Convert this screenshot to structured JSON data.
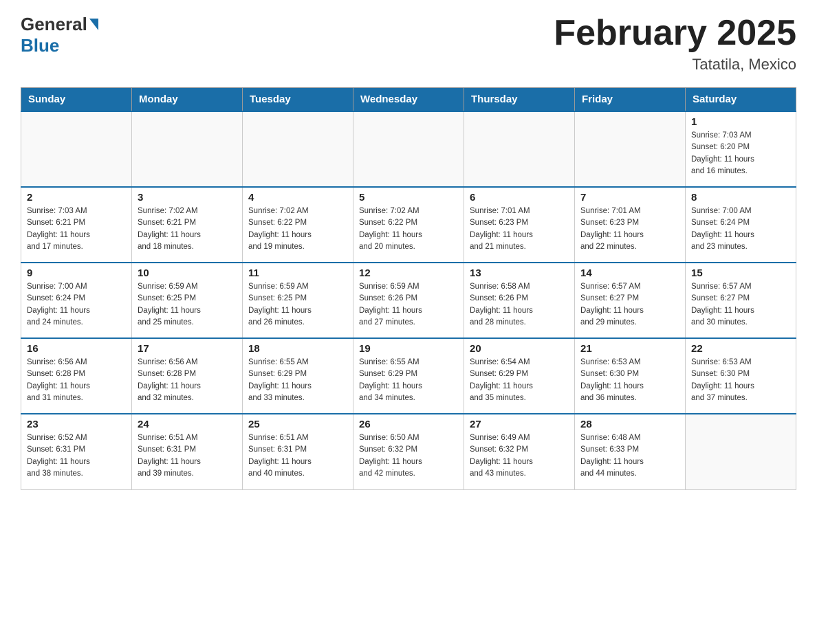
{
  "header": {
    "logo_general": "General",
    "logo_blue": "Blue",
    "title": "February 2025",
    "subtitle": "Tatatila, Mexico"
  },
  "weekdays": [
    "Sunday",
    "Monday",
    "Tuesday",
    "Wednesday",
    "Thursday",
    "Friday",
    "Saturday"
  ],
  "weeks": [
    [
      {
        "day": "",
        "info": ""
      },
      {
        "day": "",
        "info": ""
      },
      {
        "day": "",
        "info": ""
      },
      {
        "day": "",
        "info": ""
      },
      {
        "day": "",
        "info": ""
      },
      {
        "day": "",
        "info": ""
      },
      {
        "day": "1",
        "info": "Sunrise: 7:03 AM\nSunset: 6:20 PM\nDaylight: 11 hours\nand 16 minutes."
      }
    ],
    [
      {
        "day": "2",
        "info": "Sunrise: 7:03 AM\nSunset: 6:21 PM\nDaylight: 11 hours\nand 17 minutes."
      },
      {
        "day": "3",
        "info": "Sunrise: 7:02 AM\nSunset: 6:21 PM\nDaylight: 11 hours\nand 18 minutes."
      },
      {
        "day": "4",
        "info": "Sunrise: 7:02 AM\nSunset: 6:22 PM\nDaylight: 11 hours\nand 19 minutes."
      },
      {
        "day": "5",
        "info": "Sunrise: 7:02 AM\nSunset: 6:22 PM\nDaylight: 11 hours\nand 20 minutes."
      },
      {
        "day": "6",
        "info": "Sunrise: 7:01 AM\nSunset: 6:23 PM\nDaylight: 11 hours\nand 21 minutes."
      },
      {
        "day": "7",
        "info": "Sunrise: 7:01 AM\nSunset: 6:23 PM\nDaylight: 11 hours\nand 22 minutes."
      },
      {
        "day": "8",
        "info": "Sunrise: 7:00 AM\nSunset: 6:24 PM\nDaylight: 11 hours\nand 23 minutes."
      }
    ],
    [
      {
        "day": "9",
        "info": "Sunrise: 7:00 AM\nSunset: 6:24 PM\nDaylight: 11 hours\nand 24 minutes."
      },
      {
        "day": "10",
        "info": "Sunrise: 6:59 AM\nSunset: 6:25 PM\nDaylight: 11 hours\nand 25 minutes."
      },
      {
        "day": "11",
        "info": "Sunrise: 6:59 AM\nSunset: 6:25 PM\nDaylight: 11 hours\nand 26 minutes."
      },
      {
        "day": "12",
        "info": "Sunrise: 6:59 AM\nSunset: 6:26 PM\nDaylight: 11 hours\nand 27 minutes."
      },
      {
        "day": "13",
        "info": "Sunrise: 6:58 AM\nSunset: 6:26 PM\nDaylight: 11 hours\nand 28 minutes."
      },
      {
        "day": "14",
        "info": "Sunrise: 6:57 AM\nSunset: 6:27 PM\nDaylight: 11 hours\nand 29 minutes."
      },
      {
        "day": "15",
        "info": "Sunrise: 6:57 AM\nSunset: 6:27 PM\nDaylight: 11 hours\nand 30 minutes."
      }
    ],
    [
      {
        "day": "16",
        "info": "Sunrise: 6:56 AM\nSunset: 6:28 PM\nDaylight: 11 hours\nand 31 minutes."
      },
      {
        "day": "17",
        "info": "Sunrise: 6:56 AM\nSunset: 6:28 PM\nDaylight: 11 hours\nand 32 minutes."
      },
      {
        "day": "18",
        "info": "Sunrise: 6:55 AM\nSunset: 6:29 PM\nDaylight: 11 hours\nand 33 minutes."
      },
      {
        "day": "19",
        "info": "Sunrise: 6:55 AM\nSunset: 6:29 PM\nDaylight: 11 hours\nand 34 minutes."
      },
      {
        "day": "20",
        "info": "Sunrise: 6:54 AM\nSunset: 6:29 PM\nDaylight: 11 hours\nand 35 minutes."
      },
      {
        "day": "21",
        "info": "Sunrise: 6:53 AM\nSunset: 6:30 PM\nDaylight: 11 hours\nand 36 minutes."
      },
      {
        "day": "22",
        "info": "Sunrise: 6:53 AM\nSunset: 6:30 PM\nDaylight: 11 hours\nand 37 minutes."
      }
    ],
    [
      {
        "day": "23",
        "info": "Sunrise: 6:52 AM\nSunset: 6:31 PM\nDaylight: 11 hours\nand 38 minutes."
      },
      {
        "day": "24",
        "info": "Sunrise: 6:51 AM\nSunset: 6:31 PM\nDaylight: 11 hours\nand 39 minutes."
      },
      {
        "day": "25",
        "info": "Sunrise: 6:51 AM\nSunset: 6:31 PM\nDaylight: 11 hours\nand 40 minutes."
      },
      {
        "day": "26",
        "info": "Sunrise: 6:50 AM\nSunset: 6:32 PM\nDaylight: 11 hours\nand 42 minutes."
      },
      {
        "day": "27",
        "info": "Sunrise: 6:49 AM\nSunset: 6:32 PM\nDaylight: 11 hours\nand 43 minutes."
      },
      {
        "day": "28",
        "info": "Sunrise: 6:48 AM\nSunset: 6:33 PM\nDaylight: 11 hours\nand 44 minutes."
      },
      {
        "day": "",
        "info": ""
      }
    ]
  ]
}
